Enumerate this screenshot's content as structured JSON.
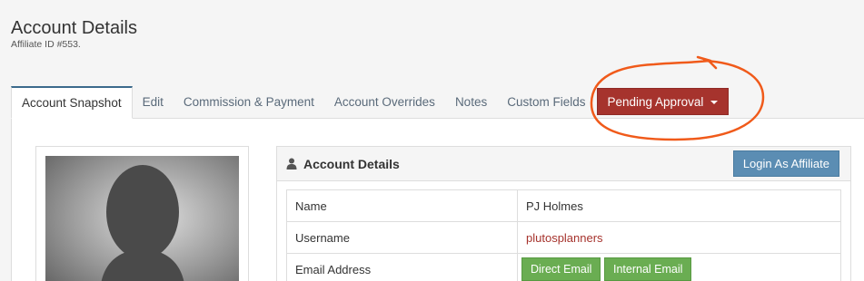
{
  "header": {
    "title": "Account Details",
    "subtitle": "Affiliate ID #553."
  },
  "tabs": [
    {
      "label": "Account Snapshot",
      "active": true
    },
    {
      "label": "Edit"
    },
    {
      "label": "Commission & Payment"
    },
    {
      "label": "Account Overrides"
    },
    {
      "label": "Notes"
    },
    {
      "label": "Custom Fields"
    }
  ],
  "status_dropdown": {
    "label": "Pending Approval",
    "color": "#a6332d"
  },
  "panel": {
    "title": "Account Details",
    "title_icon": "user-icon",
    "login_button": "Login As Affiliate"
  },
  "details": {
    "name_label": "Name",
    "name_value": "PJ Holmes",
    "username_label": "Username",
    "username_value": "plutosplanners",
    "email_label": "Email Address",
    "direct_email_button": "Direct Email",
    "internal_email_button": "Internal Email"
  },
  "annotation": {
    "shape": "hand-drawn-circle",
    "color": "#f05a1a"
  }
}
